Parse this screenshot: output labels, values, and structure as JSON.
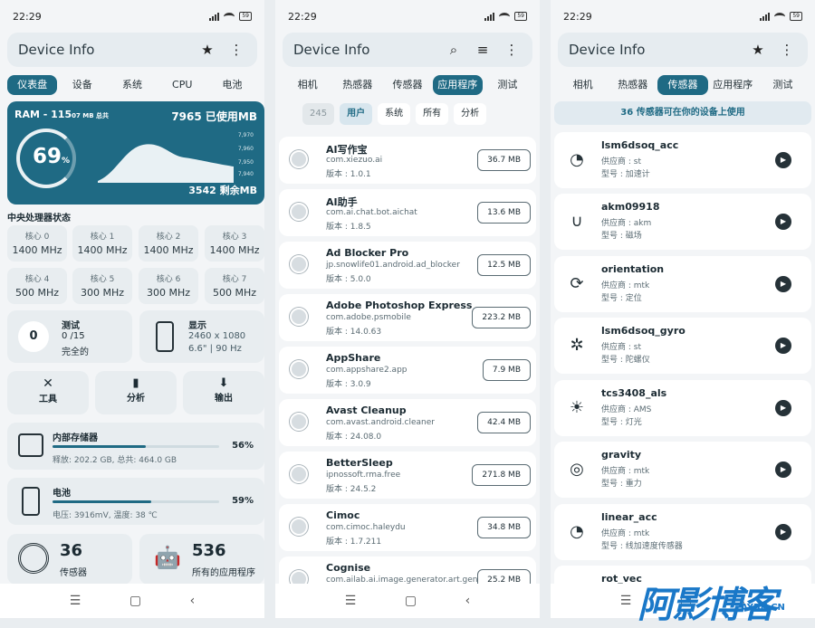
{
  "status": {
    "time": "22:29",
    "battery": "59"
  },
  "screen1": {
    "title": "Device Info",
    "tabs": [
      "仪表盘",
      "设备",
      "系统",
      "CPU",
      "电池"
    ],
    "ram": {
      "label": "RAM - 115",
      "label_sub": "07 MB 总共",
      "used": "7965 已使用MB",
      "free": "3542 剩余MB",
      "percent": "69",
      "percent_sign": "%",
      "y_labels": [
        "7,970",
        "7,960",
        "7,950",
        "7,940"
      ]
    },
    "cpu_title": "中央处理器状态",
    "cores": [
      {
        "n": "核心 0",
        "f": "1400 MHz"
      },
      {
        "n": "核心 1",
        "f": "1400 MHz"
      },
      {
        "n": "核心 2",
        "f": "1400 MHz"
      },
      {
        "n": "核心 3",
        "f": "1400 MHz"
      },
      {
        "n": "核心 4",
        "f": "500 MHz"
      },
      {
        "n": "核心 5",
        "f": "300 MHz"
      },
      {
        "n": "核心 6",
        "f": "300 MHz"
      },
      {
        "n": "核心 7",
        "f": "500 MHz"
      }
    ],
    "test": {
      "count": "0",
      "title": "测试",
      "score": "0 /15",
      "status": "完全的"
    },
    "display": {
      "title": "显示",
      "res": "2460 x 1080",
      "size": "6.6\" | 90 Hz"
    },
    "tools": [
      "工具",
      "分析",
      "输出"
    ],
    "storage": {
      "title": "内部存储器",
      "pct": "56%",
      "detail": "释放: 202.2 GB,  总共: 464.0 GB",
      "fill": 0.56
    },
    "battery": {
      "title": "电池",
      "pct": "59%",
      "detail": "电压: 3916mV,  温度: 38 ℃",
      "fill": 0.59
    },
    "sensors": {
      "count": "36",
      "label": "传感器"
    },
    "apps": {
      "count": "536",
      "label": "所有的应用程序"
    }
  },
  "screen2": {
    "title": "Device Info",
    "tabs": [
      "相机",
      "热感器",
      "传感器",
      "应用程序",
      "测试"
    ],
    "filters": [
      "245",
      "用户",
      "系统",
      "所有",
      "分析"
    ],
    "apps": [
      {
        "name": "AI写作宝",
        "pkg": "com.xiezuo.ai",
        "ver": "版本 : 1.0.1",
        "size": "36.7 MB"
      },
      {
        "name": "AI助手",
        "pkg": "com.ai.chat.bot.aichat",
        "ver": "版本 : 1.8.5",
        "size": "13.6 MB"
      },
      {
        "name": "Ad Blocker Pro",
        "pkg": "jp.snowlife01.android.ad_blocker",
        "ver": "版本 : 5.0.0",
        "size": "12.5 MB"
      },
      {
        "name": "Adobe Photoshop Express",
        "pkg": "com.adobe.psmobile",
        "ver": "版本 : 14.0.63",
        "size": "223.2 MB"
      },
      {
        "name": "AppShare",
        "pkg": "com.appshare2.app",
        "ver": "版本 : 3.0.9",
        "size": "7.9 MB"
      },
      {
        "name": "Avast Cleanup",
        "pkg": "com.avast.android.cleaner",
        "ver": "版本 : 24.08.0",
        "size": "42.4 MB"
      },
      {
        "name": "BetterSleep",
        "pkg": "ipnossoft.rma.free",
        "ver": "版本 : 24.5.2",
        "size": "271.8 MB"
      },
      {
        "name": "Cimoc",
        "pkg": "com.cimoc.haleydu",
        "ver": "版本 : 1.7.211",
        "size": "34.8 MB"
      },
      {
        "name": "Cognise",
        "pkg": "com.ailab.ai.image.generator.art.gen",
        "ver": "",
        "size": "25.2 MB"
      }
    ]
  },
  "screen3": {
    "title": "Device Info",
    "tabs": [
      "相机",
      "热感器",
      "传感器",
      "应用程序",
      "测试"
    ],
    "banner": "36 传感器可在你的设备上使用",
    "sensors": [
      {
        "name": "lsm6dsoq_acc",
        "vendor": "供应商 : st",
        "type": "型号 : 加速计",
        "icon": "gauge-icon"
      },
      {
        "name": "akm09918",
        "vendor": "供应商 : akm",
        "type": "型号 : 磁场",
        "icon": "magnet-icon"
      },
      {
        "name": "orientation",
        "vendor": "供应商 : mtk",
        "type": "型号 : 定位",
        "icon": "rotate-icon"
      },
      {
        "name": "lsm6dsoq_gyro",
        "vendor": "供应商 : st",
        "type": "型号 : 陀螺仪",
        "icon": "gyro-icon"
      },
      {
        "name": "tcs3408_als",
        "vendor": "供应商 : AMS",
        "type": "型号 : 灯光",
        "icon": "brightness-icon"
      },
      {
        "name": "gravity",
        "vendor": "供应商 : mtk",
        "type": "型号 : 重力",
        "icon": "planet-icon"
      },
      {
        "name": "linear_acc",
        "vendor": "供应商 : mtk",
        "type": "型号 : 线加速度传感器",
        "icon": "gauge-icon"
      },
      {
        "name": "rot_vec",
        "vendor": "",
        "type": "",
        "icon": "rotate-icon"
      }
    ]
  },
  "watermark": {
    "main": "阿影博客",
    "sub": "AYBK.CN"
  }
}
